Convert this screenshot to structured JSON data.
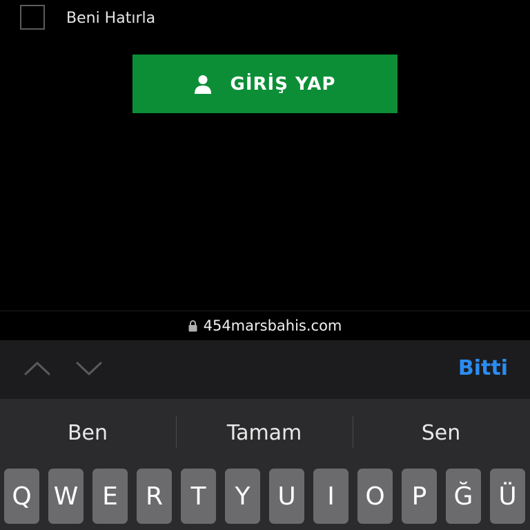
{
  "form": {
    "remember_label": "Beni Hatırla",
    "login_button_label": "GİRİŞ YAP",
    "accent_color": "#0c8e37"
  },
  "browser": {
    "url": "454marsbahis.com"
  },
  "toolbar": {
    "done_label": "Bitti",
    "done_color": "#2a8cf2"
  },
  "suggestions": [
    "Ben",
    "Tamam",
    "Sen"
  ],
  "keyboard": {
    "row1": [
      "Q",
      "W",
      "E",
      "R",
      "T",
      "Y",
      "U",
      "I",
      "O",
      "P",
      "Ğ",
      "Ü"
    ]
  }
}
